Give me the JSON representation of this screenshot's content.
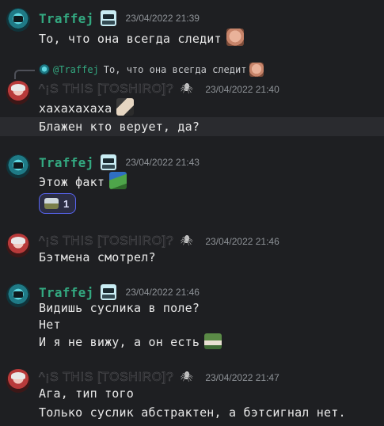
{
  "messages": [
    {
      "author": "Traffej",
      "timestamp": "23/04/2022 21:39",
      "lines": [
        "То, что она всегда следит"
      ]
    },
    {
      "author": "^¡S THIS [TOSHIRO]?",
      "timestamp": "23/04/2022 21:40",
      "reply": {
        "author": "@Traffej",
        "text": "То, что она всегда следит"
      },
      "lines": [
        "хахахахаха",
        "Блажен кто верует, да?"
      ]
    },
    {
      "author": "Traffej",
      "timestamp": "23/04/2022 21:43",
      "lines": [
        "Этож факт"
      ],
      "reaction": {
        "count": "1"
      }
    },
    {
      "author": "^¡S THIS [TOSHIRO]?",
      "timestamp": "23/04/2022 21:46",
      "lines": [
        "Бэтмена смотрел?"
      ]
    },
    {
      "author": "Traffej",
      "timestamp": "23/04/2022 21:46",
      "lines": [
        "Видишь суслика в поле?",
        "Нет",
        "И я не вижу, а он есть"
      ]
    },
    {
      "author": "^¡S THIS [TOSHIRO]?",
      "timestamp": "23/04/2022 21:47",
      "lines": [
        "Ага, тип того",
        "Только суслик абстрактен, а бэтсигнал нет."
      ]
    }
  ],
  "colors": {
    "background": "#1e1f22",
    "traffej_name": "#33a880",
    "timestamp": "#8e9297",
    "reaction_border": "#5865f2"
  },
  "icons": {
    "traffej_badge": "masked-face-icon",
    "toshiro_badge": "spider-icon",
    "reply": "reply-arrow-icon"
  }
}
